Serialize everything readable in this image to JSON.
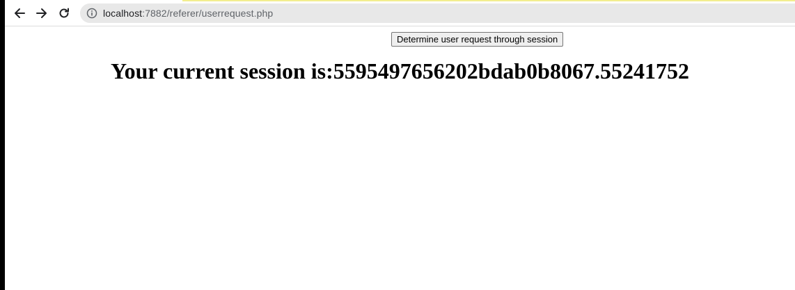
{
  "browser": {
    "url_host": "localhost",
    "url_path": ":7882/referer/userrequest.php",
    "icons": {
      "back": "back-arrow-icon",
      "forward": "forward-arrow-icon",
      "reload": "reload-icon",
      "site_info": "info-icon"
    }
  },
  "page": {
    "button_label": "Determine user request through session",
    "session_prefix": "Your current session is:",
    "session_id": "5595497656202bdab0b8067.55241752"
  }
}
